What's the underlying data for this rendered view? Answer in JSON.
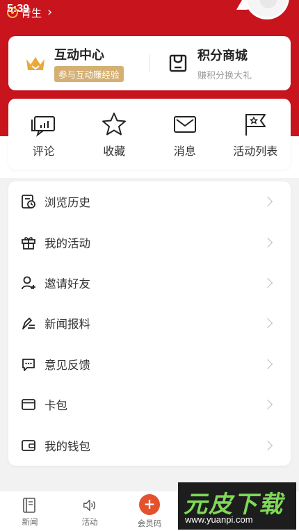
{
  "status": {
    "time": "5:39"
  },
  "header": {
    "link_label": "青生"
  },
  "top_card": {
    "left": {
      "title": "互动中心",
      "subtitle": "参与互动赚经验"
    },
    "right": {
      "title": "积分商城",
      "subtitle": "赚积分换大礼"
    }
  },
  "quick_actions": [
    {
      "label": "评论",
      "icon": "comment-icon"
    },
    {
      "label": "收藏",
      "icon": "star-icon"
    },
    {
      "label": "消息",
      "icon": "mail-icon"
    },
    {
      "label": "活动列表",
      "icon": "flag-icon"
    }
  ],
  "menu": [
    {
      "label": "浏览历史",
      "icon": "history-icon"
    },
    {
      "label": "我的活动",
      "icon": "gift-icon"
    },
    {
      "label": "邀请好友",
      "icon": "invite-user-icon"
    },
    {
      "label": "新闻报料",
      "icon": "pen-report-icon"
    },
    {
      "label": "意见反馈",
      "icon": "feedback-icon"
    },
    {
      "label": "卡包",
      "icon": "card-icon"
    },
    {
      "label": "我的钱包",
      "icon": "wallet-icon"
    }
  ],
  "tabbar": [
    {
      "label": "新闻",
      "icon": "news-icon"
    },
    {
      "label": "活动",
      "icon": "speaker-icon"
    },
    {
      "label": "会员码",
      "icon": "plus-icon"
    }
  ],
  "watermark": {
    "title": "元皮下载",
    "url": "www.yuanpi.com"
  },
  "colors": {
    "brand_red": "#c8141c",
    "gold": "#d4b073",
    "accent_orange": "#e4512c"
  }
}
